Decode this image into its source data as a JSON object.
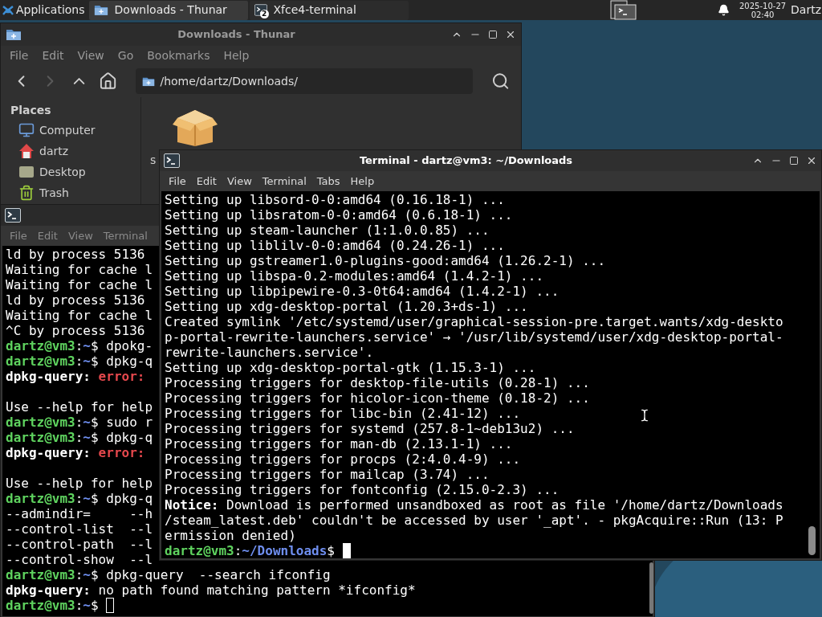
{
  "panel": {
    "apps_menu": {
      "label": "Applications"
    },
    "tasks": [
      {
        "label": "Downloads - Thunar",
        "selected": true,
        "kind": "folder"
      },
      {
        "label": "Xfce4-terminal",
        "selected": false,
        "kind": "terminal",
        "badge": "2"
      }
    ],
    "clock": {
      "date": "2025-10-27",
      "time": "02:40"
    },
    "user": "Dartz"
  },
  "file_manager": {
    "title": "Downloads - Thunar",
    "active": false,
    "menu": [
      "File",
      "Edit",
      "View",
      "Go",
      "Bookmarks",
      "Help"
    ],
    "nav": [
      {
        "kind": "back",
        "disabled": false
      },
      {
        "kind": "forward",
        "disabled": true
      },
      {
        "kind": "up",
        "disabled": false
      },
      {
        "kind": "home",
        "disabled": false
      }
    ],
    "location": "/home/dartz/Downloads/",
    "places": {
      "heading": "Places",
      "items": [
        {
          "label": "Computer",
          "kind": "computer"
        },
        {
          "label": "dartz",
          "kind": "home"
        },
        {
          "label": "Desktop",
          "kind": "desktop"
        },
        {
          "label": "Trash",
          "kind": "trash"
        }
      ]
    },
    "files": [
      {
        "label": "s",
        "kind": "package"
      }
    ]
  },
  "terminals": [
    {
      "active": false,
      "menu": [
        "File",
        "Edit",
        "View",
        "Terminal"
      ],
      "lines": [
        {
          "kind": "output",
          "text": "ld by process 5136"
        },
        {
          "kind": "output",
          "text": "Waiting for cache l"
        },
        {
          "kind": "output",
          "text": "Waiting for cache l"
        },
        {
          "kind": "output",
          "text": "ld by process 5136"
        },
        {
          "kind": "output",
          "text": "Waiting for cache l"
        },
        {
          "kind": "output",
          "text": "^C by process 5136"
        },
        {
          "kind": "prompt",
          "user": "dartz@vm3",
          "sep": ":",
          "path": "~",
          "end": "$",
          "command": "dpokg-"
        },
        {
          "kind": "prompt",
          "user": "dartz@vm3",
          "sep": ":",
          "path": "~",
          "end": "$",
          "command": "dpkg-q"
        },
        {
          "kind": "message",
          "source": "dpkg-query:",
          "text": "error:",
          "error": true
        },
        {
          "kind": "blank"
        },
        {
          "kind": "output",
          "text": "Use --help for help"
        },
        {
          "kind": "prompt",
          "user": "dartz@vm3",
          "sep": ":",
          "path": "~",
          "end": "$",
          "command": "sudo r"
        },
        {
          "kind": "prompt",
          "user": "dartz@vm3",
          "sep": ":",
          "path": "~",
          "end": "$",
          "command": "dpkg-q"
        },
        {
          "kind": "message",
          "source": "dpkg-query:",
          "text": "error:",
          "error": true
        },
        {
          "kind": "blank"
        },
        {
          "kind": "output",
          "text": "Use --help for help"
        },
        {
          "kind": "prompt",
          "user": "dartz@vm3",
          "sep": ":",
          "path": "~",
          "end": "$",
          "command": "dpkg-q"
        },
        {
          "kind": "output",
          "text": "--admindir=     --h"
        },
        {
          "kind": "output",
          "text": "--control-list  --l"
        },
        {
          "kind": "output",
          "text": "--control-path  --l"
        },
        {
          "kind": "output",
          "text": "--control-show  --l"
        },
        {
          "kind": "prompt",
          "user": "dartz@vm3",
          "sep": ":",
          "path": "~",
          "end": "$",
          "command": "dpkg-query  --search ifconfig"
        },
        {
          "kind": "message",
          "source": "dpkg-query:",
          "text": "no path found matching pattern *ifconfig*",
          "error": false
        },
        {
          "kind": "prompt",
          "user": "dartz@vm3",
          "sep": ":",
          "path": "~",
          "end": "$",
          "cursor": {
            "filled": false
          }
        }
      ]
    },
    {
      "active": true,
      "title": "Terminal - dartz@vm3: ~/Downloads",
      "menu": [
        "File",
        "Edit",
        "View",
        "Terminal",
        "Tabs",
        "Help"
      ],
      "lines": [
        {
          "kind": "output",
          "text": "Setting up libsord-0-0:amd64 (0.16.18-1) ..."
        },
        {
          "kind": "output",
          "text": "Setting up libsratom-0-0:amd64 (0.6.18-1) ..."
        },
        {
          "kind": "output",
          "text": "Setting up steam-launcher (1:1.0.0.85) ..."
        },
        {
          "kind": "output",
          "text": "Setting up liblilv-0-0:amd64 (0.24.26-1) ..."
        },
        {
          "kind": "output",
          "text": "Setting up gstreamer1.0-plugins-good:amd64 (1.26.2-1) ..."
        },
        {
          "kind": "output",
          "text": "Setting up libspa-0.2-modules:amd64 (1.4.2-1) ..."
        },
        {
          "kind": "output",
          "text": "Setting up libpipewire-0.3-0t64:amd64 (1.4.2-1) ..."
        },
        {
          "kind": "output",
          "text": "Setting up xdg-desktop-portal (1.20.3+ds-1) ..."
        },
        {
          "kind": "output",
          "text": "Created symlink '/etc/systemd/user/graphical-session-pre.target.wants/xdg-deskto"
        },
        {
          "kind": "output",
          "text": "p-portal-rewrite-launchers.service' → '/usr/lib/systemd/user/xdg-desktop-portal-"
        },
        {
          "kind": "output",
          "text": "rewrite-launchers.service'."
        },
        {
          "kind": "output",
          "text": "Setting up xdg-desktop-portal-gtk (1.15.3-1) ..."
        },
        {
          "kind": "output",
          "text": "Processing triggers for desktop-file-utils (0.28-1) ..."
        },
        {
          "kind": "output",
          "text": "Processing triggers for hicolor-icon-theme (0.18-2) ..."
        },
        {
          "kind": "output",
          "text": "Processing triggers for libc-bin (2.41-12) ..."
        },
        {
          "kind": "output",
          "text": "Processing triggers for systemd (257.8-1~deb13u2) ..."
        },
        {
          "kind": "output",
          "text": "Processing triggers for man-db (2.13.1-1) ..."
        },
        {
          "kind": "output",
          "text": "Processing triggers for procps (2:4.0.4-9) ..."
        },
        {
          "kind": "output",
          "text": "Processing triggers for mailcap (3.74) ..."
        },
        {
          "kind": "output",
          "text": "Processing triggers for fontconfig (2.15.0-2.3) ..."
        },
        {
          "kind": "output",
          "text": "**Notice:** Download is performed unsandboxed as root as file '/home/dartz/Downloads"
        },
        {
          "kind": "output",
          "text": "/steam_latest.deb' couldn't be accessed by user '_apt'. - pkgAcquire::Run (13: P"
        },
        {
          "kind": "output",
          "text": "ermission denied)"
        },
        {
          "kind": "prompt",
          "user": "dartz@vm3",
          "sep": ":",
          "path": "~/Downloads",
          "end": "$",
          "cursor": {
            "filled": true
          }
        }
      ]
    }
  ]
}
